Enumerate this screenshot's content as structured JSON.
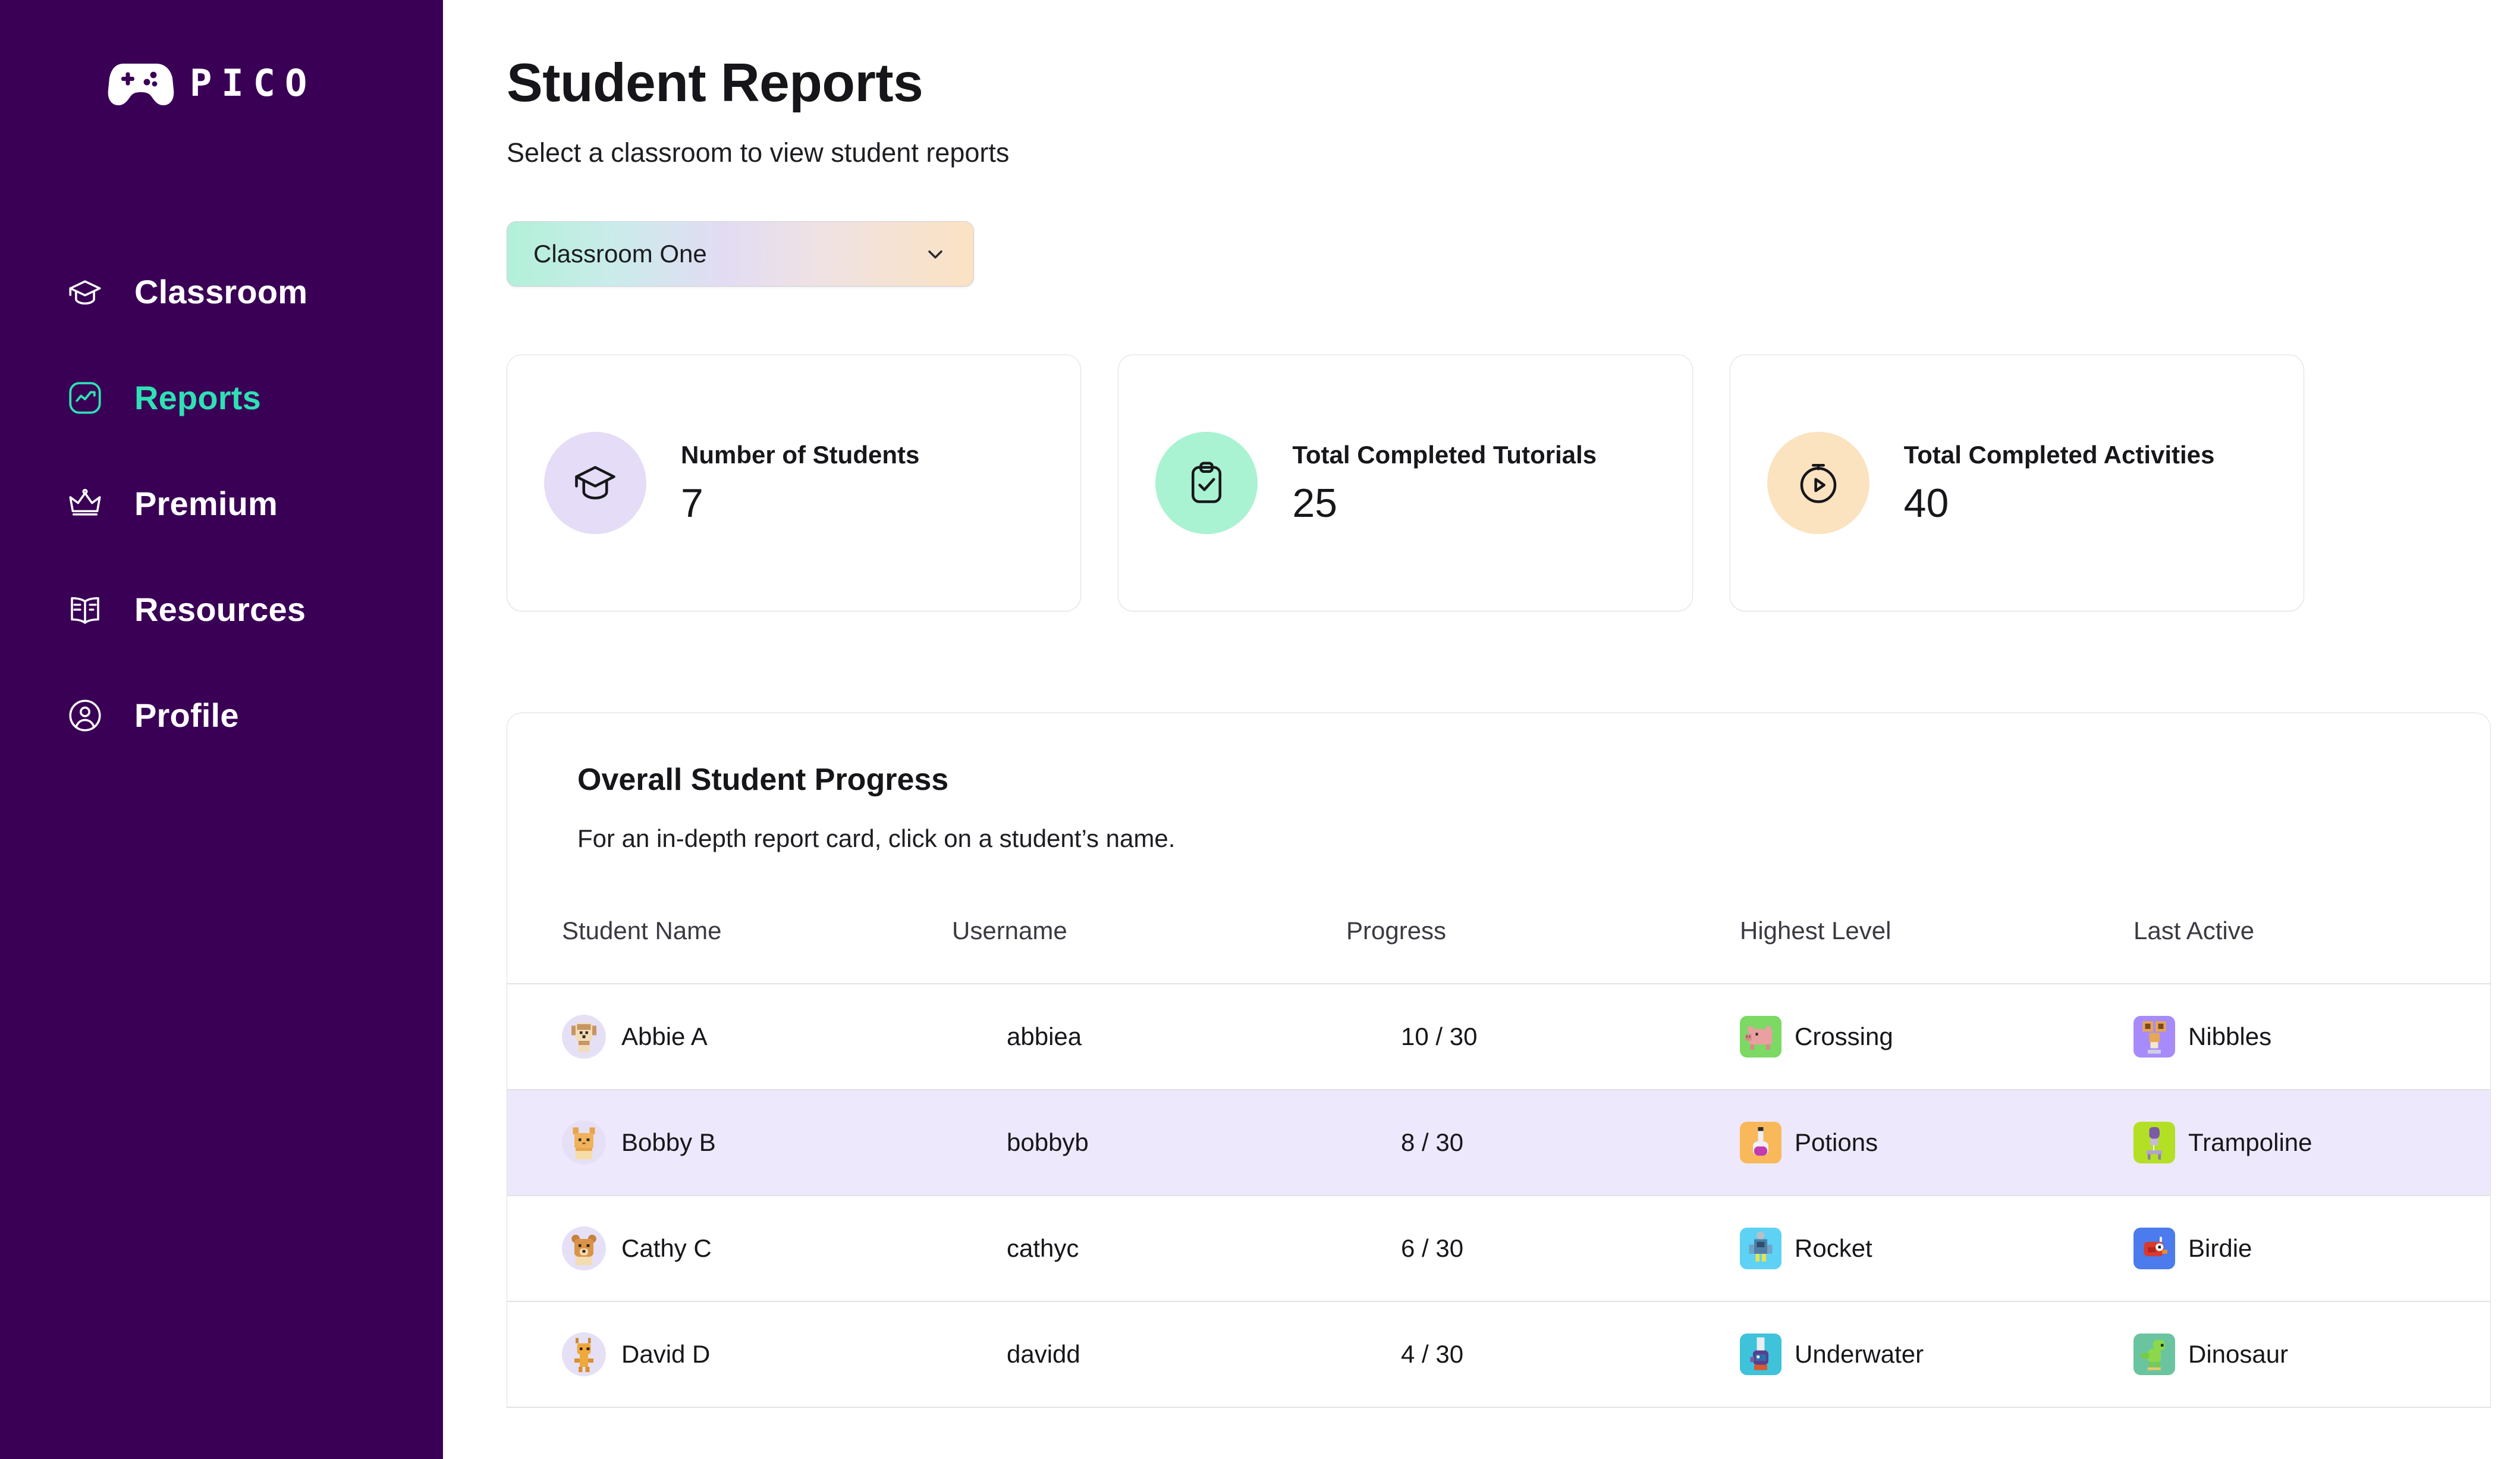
{
  "brand": {
    "name": "PICO",
    "logo_icon": "gamepad-icon",
    "sidebar_bg": "#3A0056",
    "accent": "#2FE0B4"
  },
  "sidebar": {
    "items": [
      {
        "label": "Classroom",
        "icon": "graduation-cap-icon",
        "active": false
      },
      {
        "label": "Reports",
        "icon": "trend-chart-icon",
        "active": true
      },
      {
        "label": "Premium",
        "icon": "crown-icon",
        "active": false
      },
      {
        "label": "Resources",
        "icon": "open-book-icon",
        "active": false
      },
      {
        "label": "Profile",
        "icon": "user-circle-icon",
        "active": false
      }
    ]
  },
  "header": {
    "title": "Student Reports",
    "subtitle": "Select a classroom to view student reports"
  },
  "classroom_select": {
    "value": "Classroom One",
    "icon": "chevron-down-icon",
    "gradient_stops": [
      "#B2F0D8",
      "#E2DCF3",
      "#FBE2C3"
    ]
  },
  "stats": [
    {
      "label": "Number of Students",
      "value": "7",
      "icon": "graduation-cap-icon",
      "badge_color": "#E5DCF7"
    },
    {
      "label": "Total Completed Tutorials",
      "value": "25",
      "icon": "clipboard-check-icon",
      "badge_color": "#A9F2D2"
    },
    {
      "label": "Total Completed Activities",
      "value": "40",
      "icon": "stopwatch-play-icon",
      "badge_color": "#FBE3C0"
    }
  ],
  "progress_panel": {
    "title": "Overall Student Progress",
    "subtitle": "For an in-depth report card, click on a student’s name.",
    "columns": [
      "Student Name",
      "Username",
      "Progress",
      "Highest Level",
      "Last Active"
    ],
    "rows": [
      {
        "name": "Abbie A",
        "username": "abbiea",
        "progress": "10 / 30",
        "highest_level": "Crossing",
        "highest_level_color": "#7BD964",
        "highest_level_icon": "pig-icon",
        "last_active": "Nibbles",
        "last_active_color": "#A78BFA",
        "last_active_icon": "nibbles-icon",
        "highlighted": false
      },
      {
        "name": "Bobby B",
        "username": "bobbyb",
        "progress": "8 / 30",
        "highest_level": "Potions",
        "highest_level_color": "#F9B85A",
        "highest_level_icon": "potion-icon",
        "last_active": "Trampoline",
        "last_active_color": "#B3E025",
        "last_active_icon": "trampoline-icon",
        "highlighted": true
      },
      {
        "name": "Cathy C",
        "username": "cathyc",
        "progress": "6 / 30",
        "highest_level": "Rocket",
        "highest_level_color": "#5ED2F5",
        "highest_level_icon": "rocket-icon",
        "last_active": "Birdie",
        "last_active_color": "#4B7BEC",
        "last_active_icon": "birdie-icon",
        "highlighted": false
      },
      {
        "name": "David D",
        "username": "davidd",
        "progress": "4 / 30",
        "highest_level": "Underwater",
        "highest_level_color": "#3EC3DA",
        "highest_level_icon": "underwater-icon",
        "last_active": "Dinosaur",
        "last_active_color": "#6BC4A0",
        "last_active_icon": "dinosaur-icon",
        "highlighted": false
      }
    ]
  }
}
